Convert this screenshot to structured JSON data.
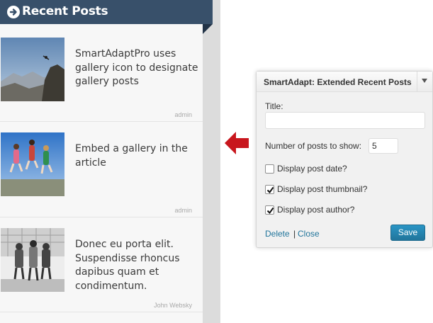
{
  "sidebar": {
    "title": "Recent Posts",
    "posts": [
      {
        "title": "SmartAdaptPro uses gallery icon to designate gallery posts",
        "author": "admin"
      },
      {
        "title": "Embed a gallery in the article",
        "author": "admin"
      },
      {
        "title": "Donec eu porta elit. Suspendisse rhoncus dapibus quam et condimentum.",
        "author": "John Websky"
      }
    ]
  },
  "panel": {
    "title": "SmartAdapt: Extended Recent Posts",
    "title_label": "Title:",
    "title_value": "",
    "num_label": "Number of posts to show:",
    "num_value": "5",
    "checkboxes": [
      {
        "label": "Display post date?",
        "checked": false
      },
      {
        "label": "Display post thumbnail?",
        "checked": true
      },
      {
        "label": "Display post author?",
        "checked": true
      }
    ],
    "delete_label": "Delete",
    "separator": "|",
    "close_label": "Close",
    "save_label": "Save"
  },
  "colors": {
    "header": "#38506a",
    "accent_link": "#21759b",
    "arrow": "#c8161d",
    "save_button": "#21759b"
  }
}
